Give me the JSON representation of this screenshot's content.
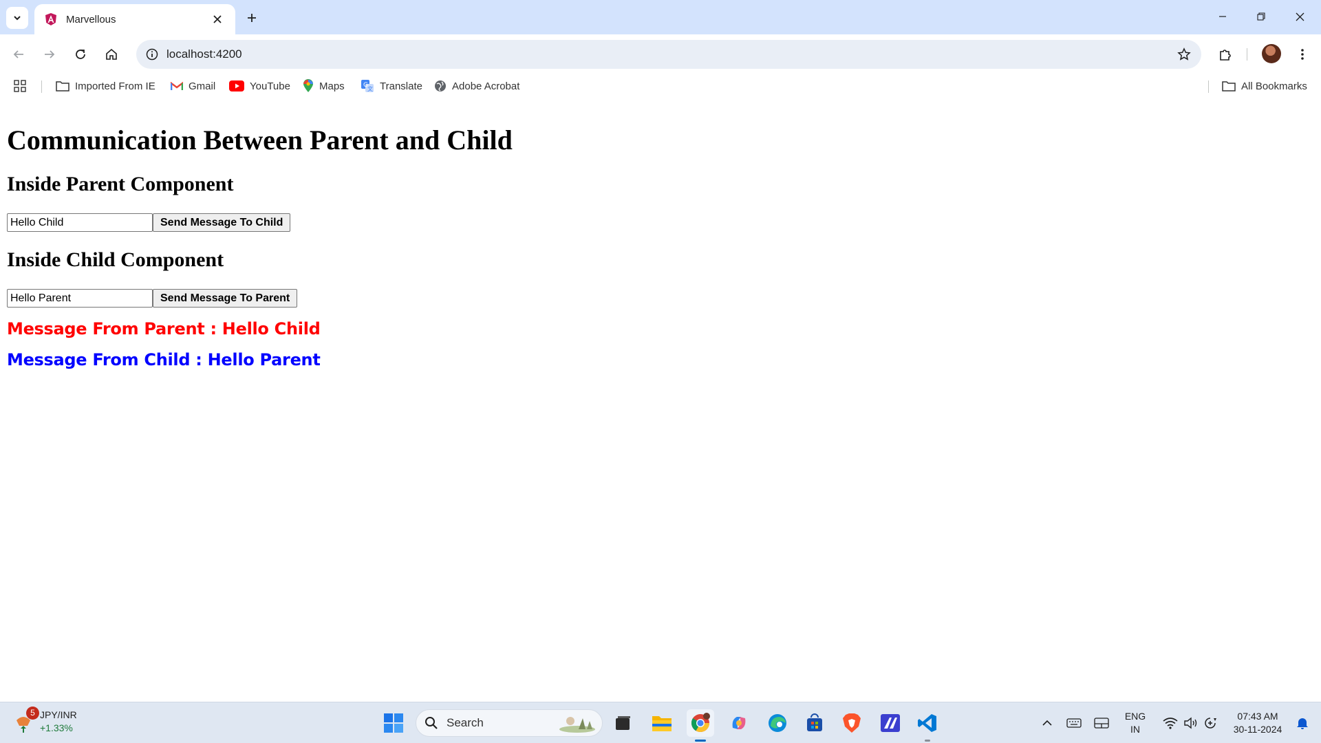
{
  "browser": {
    "tab_title": "Marvellous",
    "url": "localhost:4200"
  },
  "bookmarks": [
    {
      "label": "Imported From IE",
      "icon": "folder-icon"
    },
    {
      "label": "Gmail",
      "icon": "gmail-icon"
    },
    {
      "label": "YouTube",
      "icon": "youtube-icon"
    },
    {
      "label": "Maps",
      "icon": "maps-icon"
    },
    {
      "label": "Translate",
      "icon": "translate-icon"
    },
    {
      "label": "Adobe Acrobat",
      "icon": "globe-icon"
    }
  ],
  "all_bookmarks_label": "All Bookmarks",
  "page": {
    "title": "Communication Between Parent and Child",
    "parent": {
      "heading": "Inside Parent Component",
      "input_value": "Hello Child",
      "button_label": "Send Message To Child"
    },
    "child": {
      "heading": "Inside Child Component",
      "input_value": "Hello Parent",
      "button_label": "Send Message To Parent"
    },
    "message_from_parent": "Message From Parent : Hello Child",
    "message_from_child": "Message From Child : Hello Parent",
    "colors": {
      "parent_message": "#ff0000",
      "child_message": "#0000ff"
    }
  },
  "taskbar": {
    "widget_badge": "5",
    "widget_title": "JPY/INR",
    "widget_change": "+1.33%",
    "search_label": "Search",
    "lang_top": "ENG",
    "lang_bottom": "IN",
    "time": "07:43 AM",
    "date": "30-11-2024"
  }
}
